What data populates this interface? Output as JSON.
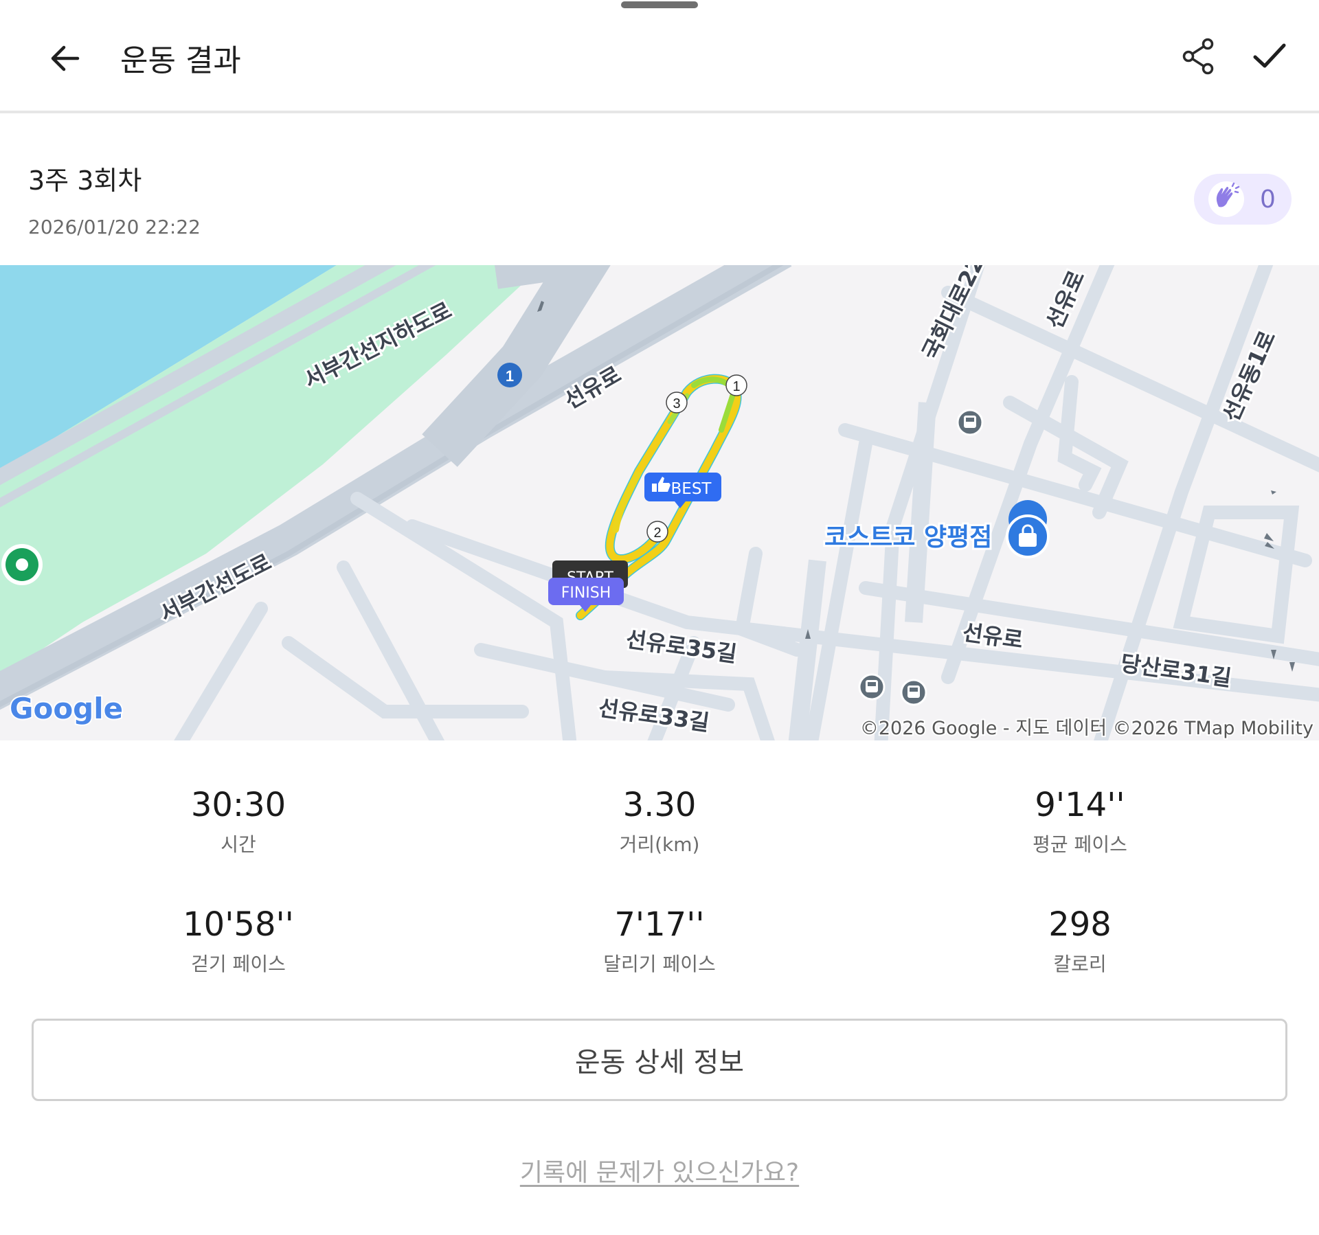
{
  "header": {
    "title": "운동 결과",
    "back_icon": "arrow-left-icon",
    "share_icon": "share-icon",
    "confirm_icon": "check-icon"
  },
  "workout": {
    "name": "3주 3회차",
    "datetime": "2026/01/20 22:22",
    "clap_count": "0",
    "clap_icon": "clap-hands-icon"
  },
  "map": {
    "roads": {
      "r1": "서부간선지하도로",
      "r2": "서부간선도로",
      "r3": "선유로",
      "r4": "국회대로22",
      "r5": "선유로",
      "r6": "선유동1로",
      "r7": "선유로35길",
      "r8": "선유로",
      "r9": "당산로31길",
      "r10": "선유로33길"
    },
    "route_shield": "1",
    "poi": "코스트코 양평점",
    "markers": {
      "best": "BEST",
      "start": "START",
      "finish": "FINISH",
      "lap1": "1",
      "lap2": "2",
      "lap3": "3"
    },
    "google_logo": "Google",
    "attribution": "©2026 Google - 지도 데이터 ©2026 TMap Mobility",
    "colors": {
      "water": "#8fd8ec",
      "park": "#bff0d6",
      "road": "#d3dbe4",
      "route_yellow": "#f4d21a",
      "route_green": "#9bdc3a",
      "best_marker": "#2f6cf2",
      "finish_marker": "#6c6cf0"
    }
  },
  "stats": [
    {
      "value": "30:30",
      "label": "시간"
    },
    {
      "value": "3.30",
      "label": "거리(km)"
    },
    {
      "value": "9'14''",
      "label": "평균 페이스"
    },
    {
      "value": "10'58''",
      "label": "걷기 페이스"
    },
    {
      "value": "7'17''",
      "label": "달리기 페이스"
    },
    {
      "value": "298",
      "label": "칼로리"
    }
  ],
  "detail_button": "운동 상세 정보",
  "report_link": "기록에 문제가 있으신가요?"
}
